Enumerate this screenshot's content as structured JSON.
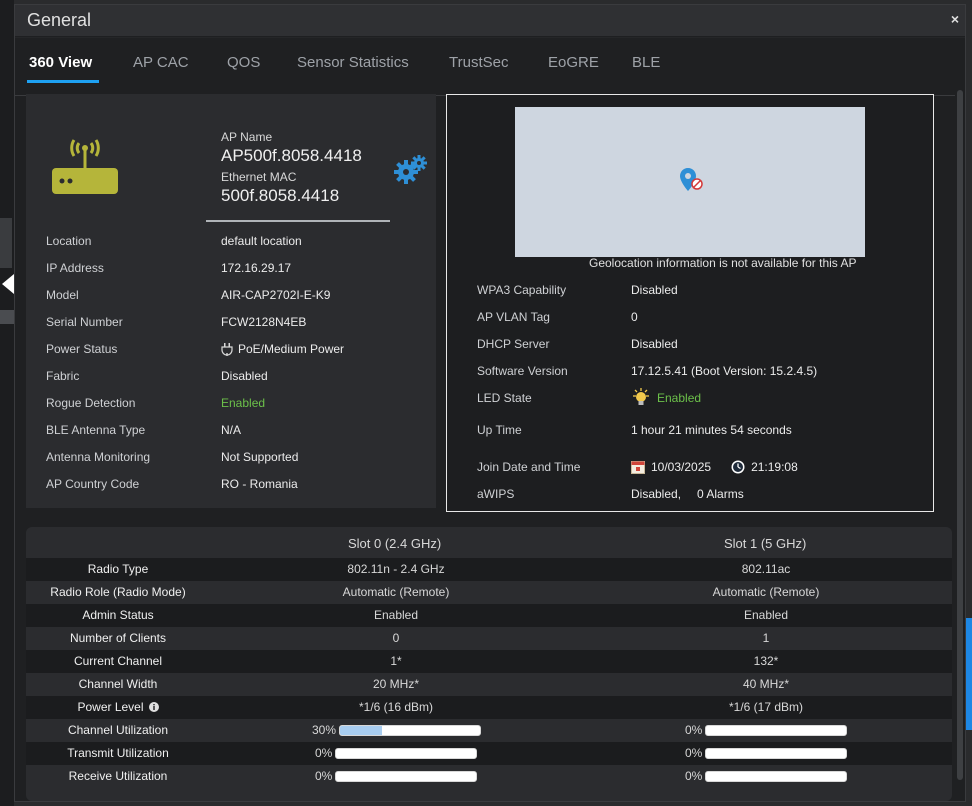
{
  "dialog": {
    "title": "General",
    "close_label": "×"
  },
  "tabs": [
    {
      "label": "360 View",
      "active": true
    },
    {
      "label": "AP CAC"
    },
    {
      "label": "QOS"
    },
    {
      "label": "Sensor Statistics"
    },
    {
      "label": "TrustSec"
    },
    {
      "label": "EoGRE"
    },
    {
      "label": "BLE"
    }
  ],
  "ap": {
    "name_label": "AP Name",
    "name": "AP500f.8058.4418",
    "eth_label": "Ethernet MAC",
    "eth_mac": "500f.8058.4418"
  },
  "details": [
    {
      "label": "Location",
      "value": "default location"
    },
    {
      "label": "IP Address",
      "value": "172.16.29.17"
    },
    {
      "label": "Model",
      "value": "AIR-CAP2702I-E-K9"
    },
    {
      "label": "Serial Number",
      "value": "FCW2128N4EB"
    },
    {
      "label": "Power Status",
      "value": "PoE/Medium Power"
    },
    {
      "label": "Fabric",
      "value": "Disabled"
    },
    {
      "label": "Rogue Detection",
      "value": "Enabled"
    },
    {
      "label": "BLE Antenna Type",
      "value": "N/A"
    },
    {
      "label": "Antenna Monitoring",
      "value": "Not Supported"
    },
    {
      "label": "AP Country Code",
      "value": "RO - Romania"
    }
  ],
  "geo": {
    "message": "Geolocation information is not available for this AP"
  },
  "status": {
    "wpa3_label": "WPA3 Capability",
    "wpa3": "Disabled",
    "vlan_label": "AP VLAN Tag",
    "vlan": "0",
    "dhcp_label": "DHCP Server",
    "dhcp": "Disabled",
    "sw_label": "Software Version",
    "sw": "17.12.5.41 (Boot Version: 15.2.4.5)",
    "led_label": "LED State",
    "led": "Enabled",
    "uptime_label": "Up Time",
    "uptime": "1 hour 21 minutes 54 seconds",
    "join_label": "Join Date and Time",
    "join_date": "10/03/2025",
    "join_time": "21:19:08",
    "awips_label": "aWIPS",
    "awips": "Disabled,",
    "awips_alarms": "0 Alarms"
  },
  "slots": {
    "headers": [
      "Slot 0 (2.4 GHz)",
      "Slot 1 (5 GHz)"
    ],
    "rows": [
      {
        "label": "Radio Type",
        "s0": "802.11n - 2.4 GHz",
        "s1": "802.11ac"
      },
      {
        "label": "Radio Role (Radio Mode)",
        "s0": "Automatic (Remote)",
        "s1": "Automatic (Remote)"
      },
      {
        "label": "Admin Status",
        "s0": "Enabled",
        "s1": "Enabled"
      },
      {
        "label": "Number of Clients",
        "s0": "0",
        "s1": "1"
      },
      {
        "label": "Current Channel",
        "s0": "1*",
        "s1": "132*"
      },
      {
        "label": "Channel Width",
        "s0": "20 MHz*",
        "s1": "40 MHz*"
      },
      {
        "label": "Power Level",
        "s0": "*1/6 (16 dBm)",
        "s1": "*1/6 (17 dBm)"
      }
    ],
    "util": [
      {
        "label": "Channel Utilization",
        "s0": "30%",
        "s0_fraction": 0.3,
        "s1": "0%",
        "s1_fraction": 0
      },
      {
        "label": "Transmit Utilization",
        "s0": "0%",
        "s0_fraction": 0,
        "s1": "0%",
        "s1_fraction": 0
      },
      {
        "label": "Receive Utilization",
        "s0": "0%",
        "s0_fraction": 0,
        "s1": "0%",
        "s1_fraction": 0
      }
    ]
  },
  "colors": {
    "accent": "#1ea1f2",
    "enabled_green": "#6cc04a",
    "router_olive": "#b5b53a"
  }
}
